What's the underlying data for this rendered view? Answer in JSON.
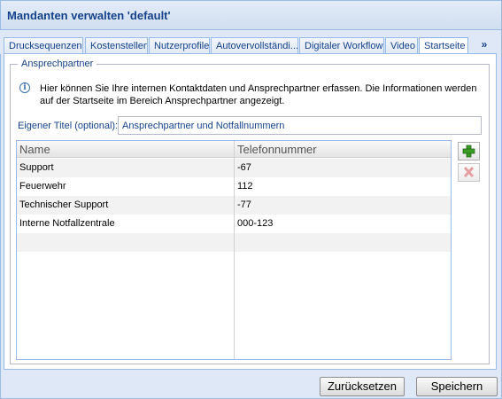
{
  "window": {
    "title": "Mandanten verwalten 'default'"
  },
  "tabs": [
    {
      "label": "Drucksequenzen"
    },
    {
      "label": "Kostenstellen"
    },
    {
      "label": "Nutzerprofile"
    },
    {
      "label": "Autovervollständi..."
    },
    {
      "label": "Digitaler Workflow"
    },
    {
      "label": "Video"
    },
    {
      "label": "Startseite",
      "active": true
    }
  ],
  "tab_scroll": {
    "label": "»",
    "icon": "double-chevron-right-icon"
  },
  "fieldset": {
    "legend": "Ansprechpartner"
  },
  "info": {
    "icon": "info-icon",
    "text": "Hier können Sie Ihre internen Kontaktdaten und Ansprechpartner erfassen. Die Informationen werden auf der Startseite im Bereich Ansprechpartner angezeigt."
  },
  "custom_title": {
    "label": "Eigener Titel (optional):",
    "value": "Ansprechpartner und Notfallnummern"
  },
  "grid": {
    "columns": [
      "Name",
      "Telefonnummer"
    ],
    "rows": [
      {
        "name": "Support",
        "phone": "-67"
      },
      {
        "name": "Feuerwehr",
        "phone": "112"
      },
      {
        "name": "Technischer Support",
        "phone": "-77"
      },
      {
        "name": "Interne Notfallzentrale",
        "phone": "000-123"
      },
      {
        "name": "",
        "phone": ""
      }
    ]
  },
  "grid_buttons": {
    "add_icon": "plus-icon",
    "delete_icon": "delete-x-icon"
  },
  "footer": {
    "reset_label": "Zurücksetzen",
    "save_label": "Speichern"
  },
  "colors": {
    "accent": "#15428b",
    "border": "#99bbe8",
    "window_bg": "#dfe8f6",
    "add_green": "#3a9d23",
    "delete_red": "#d06060"
  }
}
